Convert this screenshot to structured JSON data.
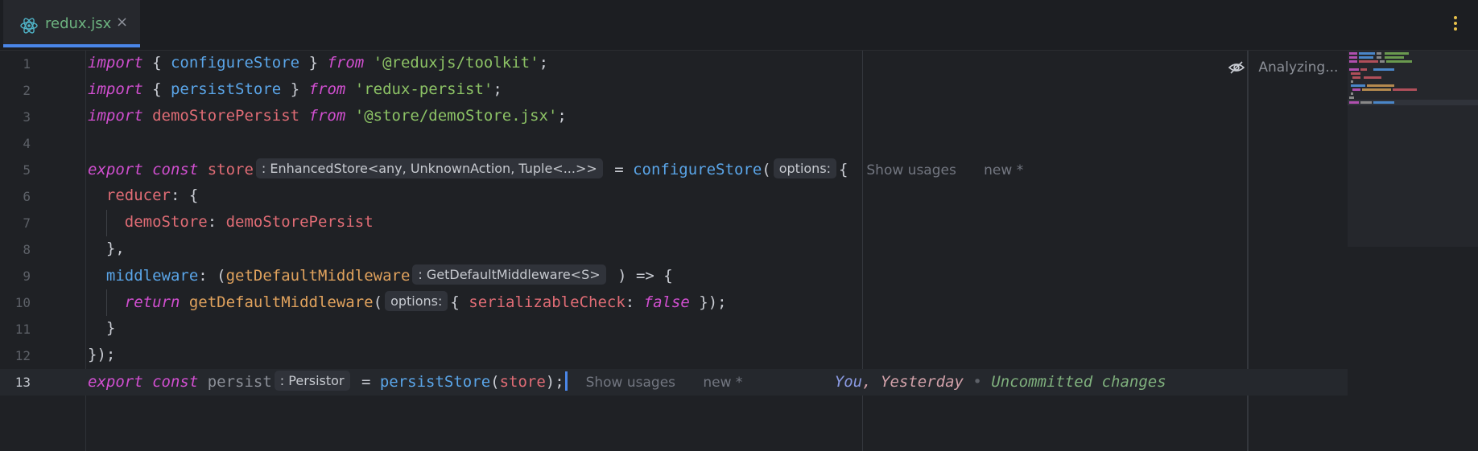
{
  "tab": {
    "label": "redux.jsx",
    "close": "×"
  },
  "status": {
    "analyzing": "Analyzing..."
  },
  "hints": {
    "store_type": ": EnhancedStore<any, UnknownAction, Tuple<...>>",
    "options": "options:",
    "gdm_type": ": GetDefaultMiddleware<S>",
    "persistor_type": ": Persistor",
    "show_usages": "Show usages",
    "new": "new *"
  },
  "blame": {
    "author": "You",
    "sep": ",",
    "when": "Yesterday",
    "dot": "•",
    "message": "Uncommitted changes"
  },
  "line_numbers": [
    "1",
    "2",
    "3",
    "4",
    "5",
    "6",
    "7",
    "8",
    "9",
    "10",
    "11",
    "12",
    "13"
  ],
  "code": {
    "l1": {
      "import": "import",
      "open": " { ",
      "name": "configureStore",
      "close": " } ",
      "from": "from",
      "src": " '@reduxjs/toolkit'",
      "end": ";"
    },
    "l2": {
      "import": "import",
      "open": " { ",
      "name": "persistStore",
      "close": " } ",
      "from": "from",
      "src": " 'redux-persist'",
      "end": ";"
    },
    "l3": {
      "import": "import",
      "name": " demoStorePersist ",
      "from": "from",
      "src": " '@store/demoStore.jsx'",
      "end": ";"
    },
    "l5": {
      "export": "export",
      "const": " const ",
      "name": "store",
      "eq": " = ",
      "fn": "configureStore",
      "paren": "(",
      "brace": "{"
    },
    "l6": {
      "prop": "reducer",
      "rest": ": {"
    },
    "l7": {
      "prop": "demoStore",
      "colon": ": ",
      "val": "demoStorePersist"
    },
    "l8": {
      "text": "},"
    },
    "l9": {
      "prop": "middleware",
      "colon": ": (",
      "param": "getDefaultMiddleware",
      "rest": " ) => {"
    },
    "l10": {
      "return": "return",
      "fn": " getDefaultMiddleware",
      "paren": "(",
      "brace": "{ ",
      "prop": "serializableCheck",
      "colon": ": ",
      "false": "false",
      "end": " });"
    },
    "l11": {
      "text": "}"
    },
    "l12": {
      "text": "});"
    },
    "l13": {
      "export": "export",
      "const": " const ",
      "name": "persist",
      "eq": " = ",
      "fn": "persistStore",
      "open": "(",
      "arg": "store",
      "end": ");"
    }
  },
  "colors": {
    "accent": "#4a86e8",
    "tab_text": "#6db380",
    "keyword": "#d14fd0",
    "function": "#5aa5e8",
    "string": "#8cc265"
  }
}
